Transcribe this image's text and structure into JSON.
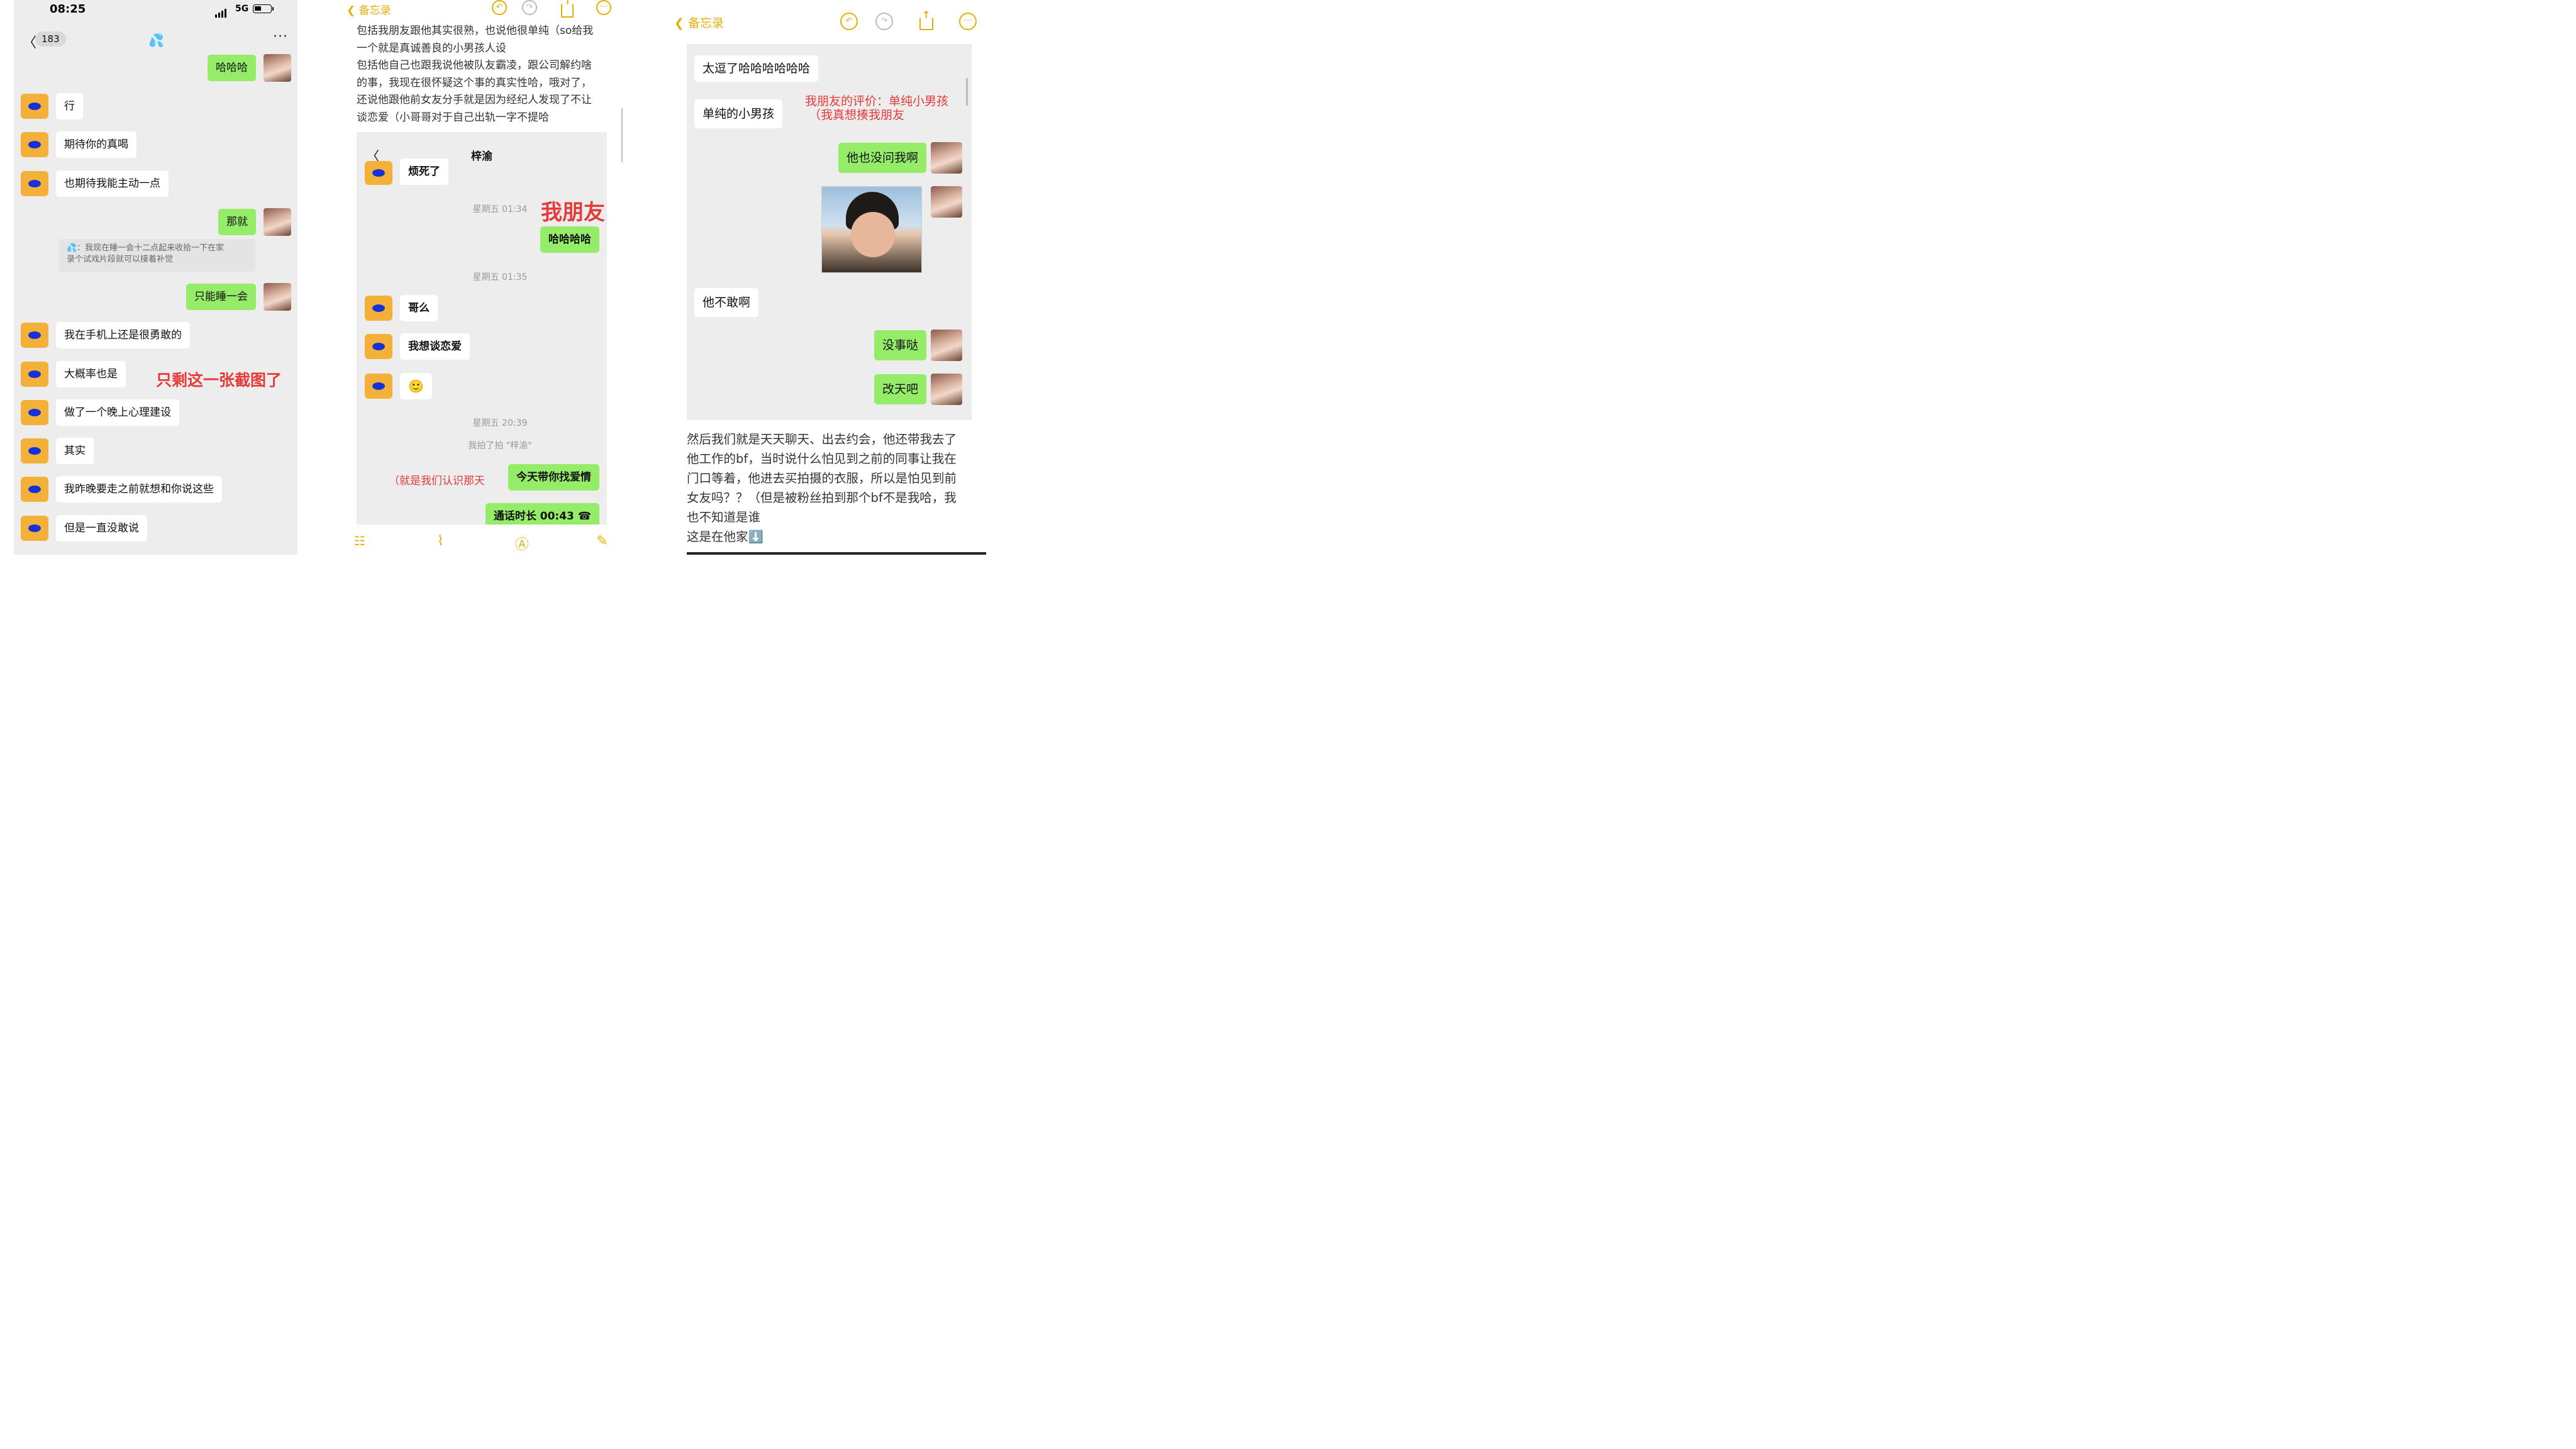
{
  "p1": {
    "time": "08:25",
    "network": "5G",
    "badge": "183",
    "title_emoji": "💦",
    "more": "···",
    "back": "〈",
    "messages": [
      {
        "side": "right",
        "text": "哈哈哈"
      },
      {
        "side": "left",
        "text": "行"
      },
      {
        "side": "left",
        "text": "期待你的真喝"
      },
      {
        "side": "left",
        "text": "也期待我能主动一点"
      },
      {
        "side": "right",
        "text": "那就"
      },
      {
        "side": "right",
        "text": "只能睡一会"
      },
      {
        "side": "left",
        "text": "我在手机上还是很勇敢的"
      },
      {
        "side": "left",
        "text": "大概率也是"
      },
      {
        "side": "left",
        "text": "做了一个晚上心理建设"
      },
      {
        "side": "left",
        "text": "其实"
      },
      {
        "side": "left",
        "text": "我昨晚要走之前就想和你说这些"
      },
      {
        "side": "left",
        "text": "但是一直没敢说"
      }
    ],
    "system_line1": "💦：我现在睡一会十二点起来收拾一下在家",
    "system_line2": "录个试戏片段就可以接着补觉",
    "annotation": "只剩这一张截图了"
  },
  "p2": {
    "back_label": "备忘录",
    "text_lines": [
      "包括我朋友跟他其实很熟，也说他很单纯（so给我",
      "一个就是真诚善良的小男孩人设",
      "包括他自己也跟我说他被队友霸凌，跟公司解约啥",
      "的事，我现在很怀疑这个事的真实性哈，哦对了，",
      "还说他跟他前女友分手就是因为经纪人发现了不让",
      "谈恋爱（小哥哥对于自己出轨一字不提哈"
    ],
    "chat": {
      "title": "梓渝",
      "back": "〈",
      "partial_msg": "烦死了",
      "ts1": "星期五 01:34",
      "friend_label": "我朋友",
      "msg_right1": "哈哈哈哈",
      "ts2": "星期五 01:35",
      "msg_left1": "哥么",
      "msg_left2": "我想谈恋爱",
      "msg_left3": "🙂",
      "ts3": "星期五 20:39",
      "pat": "我拍了拍 \"梓渝\"",
      "annotation": "（就是我们认识那天",
      "msg_right2": "今天带你找爱情",
      "call": "通话时长 00:43"
    }
  },
  "p3": {
    "back_label": "备忘录",
    "chat": {
      "msg1": "太逗了哈哈哈哈哈哈",
      "msg2": "单纯的小男孩",
      "red1": "我朋友的评价：单纯小男孩",
      "red2": "（我真想揍我朋友",
      "msg3": "他也没问我啊",
      "msg4": "他不敢啊",
      "msg5": "没事哒",
      "msg6": "改天吧"
    },
    "text_lines": [
      "然后我们就是天天聊天、出去约会，他还带我去了",
      "他工作的bf，当时说什么怕见到之前的同事让我在",
      "门口等着，他进去买拍摄的衣服，所以是怕见到前",
      "女友吗？？（但是被粉丝拍到那个bf不是我哈，我",
      "也不知道是谁",
      "这是在他家⬇️"
    ]
  },
  "colors": {
    "wechat_green": "#95ec69",
    "notes_yellow": "#e2b106",
    "annotation_red": "#e53a3a"
  }
}
